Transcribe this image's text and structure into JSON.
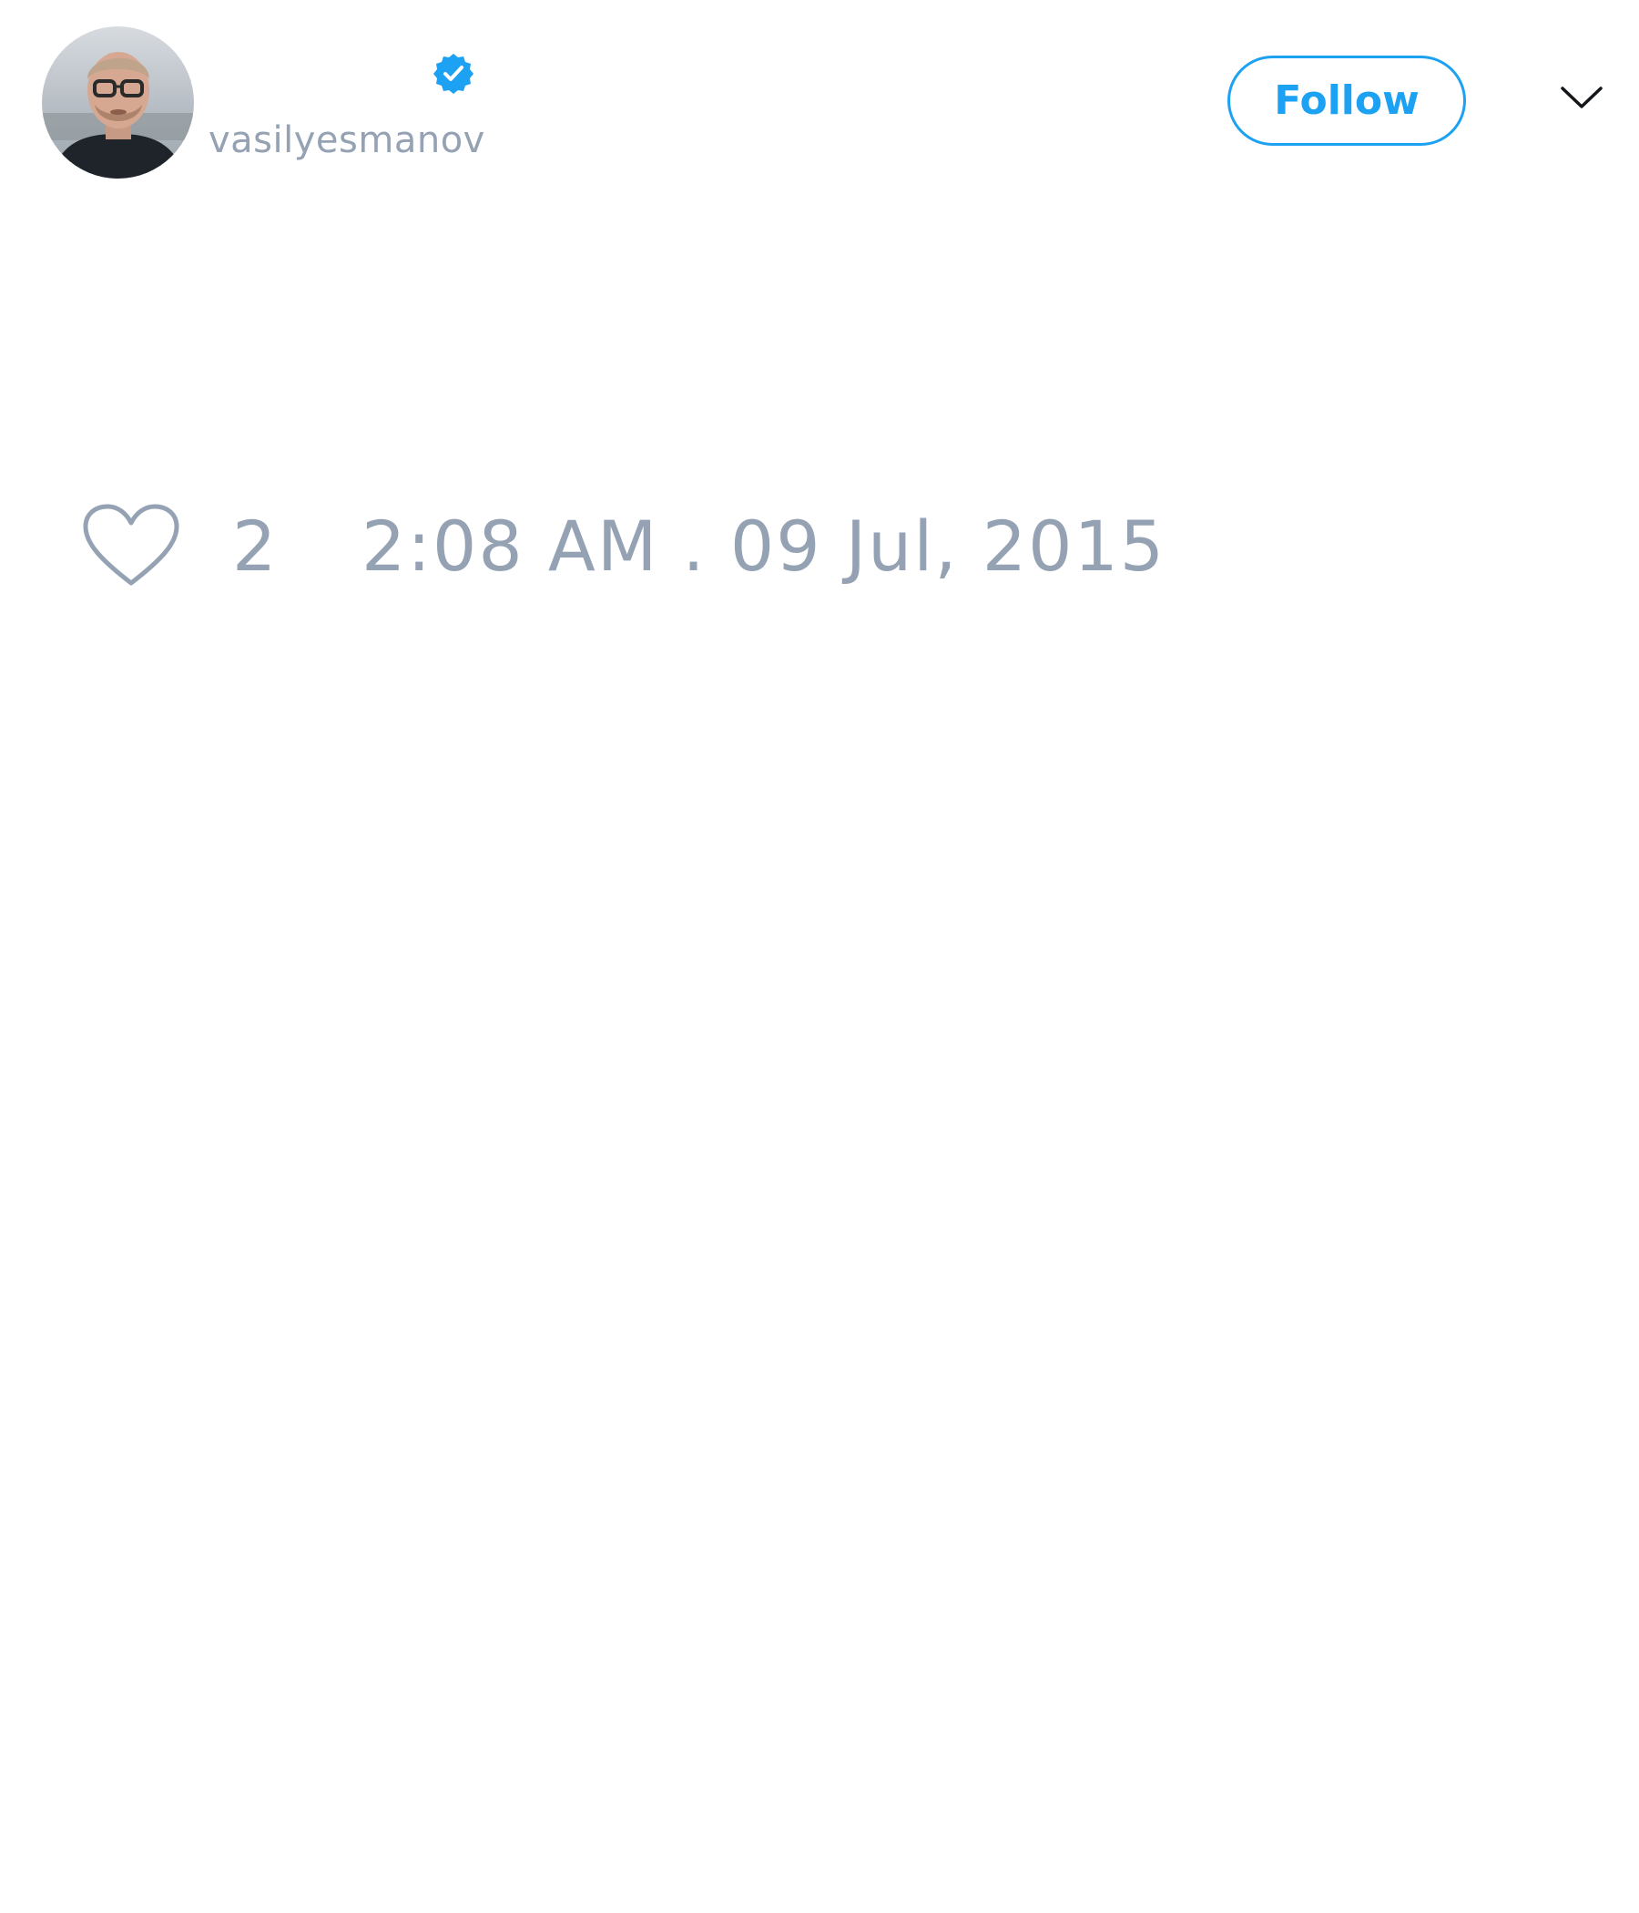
{
  "tweet": {
    "author": {
      "display_name": "",
      "handle": "vasilyesmanov",
      "verified": true,
      "avatar_icon": "user-avatar-photo"
    },
    "follow_label": "Follow",
    "menu_icon": "chevron-down-icon",
    "likes": {
      "icon": "heart-outline-icon",
      "count": "2"
    },
    "timestamp": "2:08 AM . 09 Jul, 2015"
  },
  "colors": {
    "accent": "#1da1f2",
    "muted_text": "#94a2b4",
    "background": "#ffffff"
  }
}
